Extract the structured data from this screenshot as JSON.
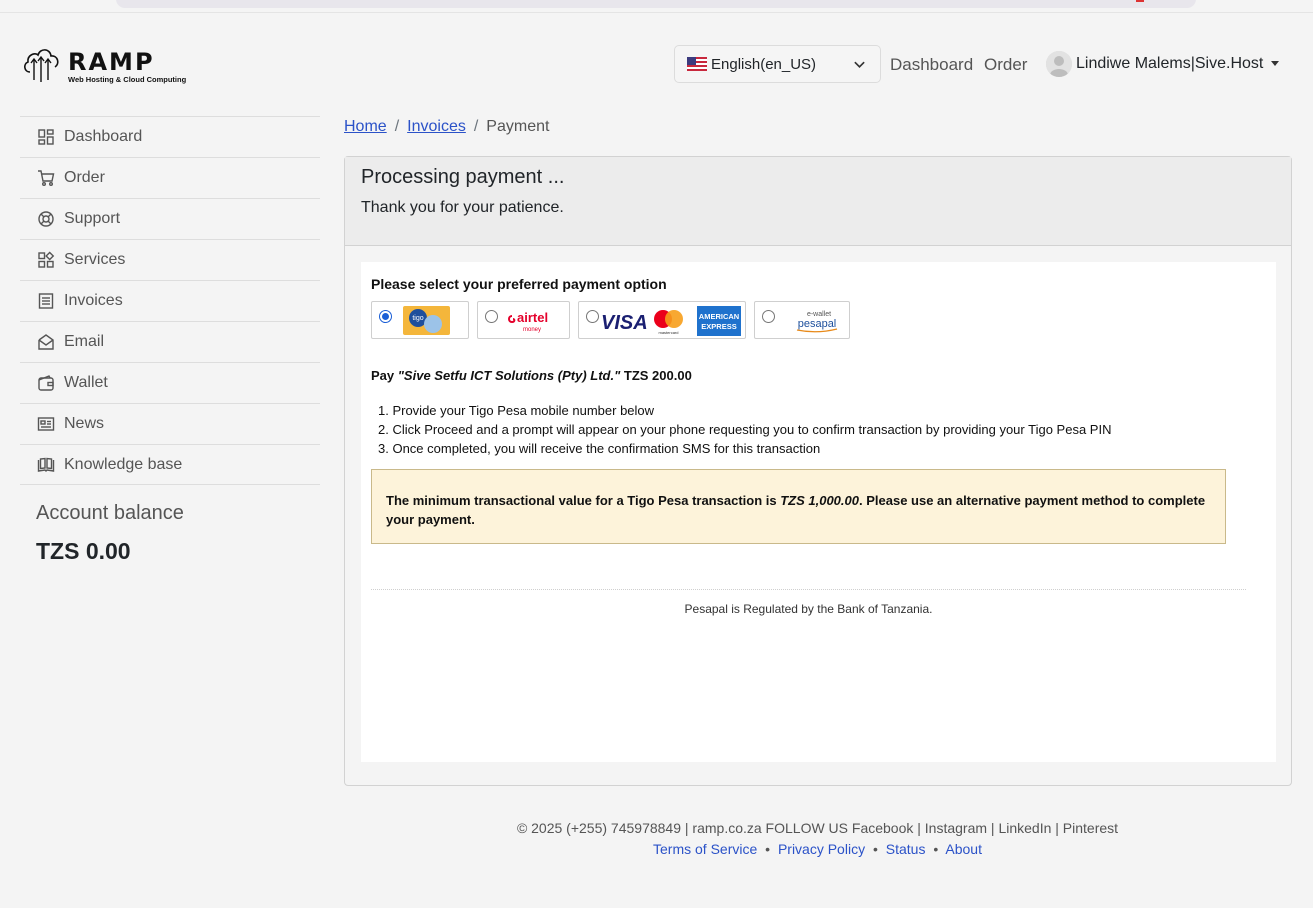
{
  "brand": {
    "name": "RAMP",
    "tagline": "Web Hosting & Cloud Computing"
  },
  "header": {
    "language": "English(en_US)",
    "nav": [
      "Dashboard",
      "Order"
    ],
    "user": "Lindiwe Malems|Sive.Host"
  },
  "sidebar": {
    "items": [
      {
        "label": "Dashboard",
        "icon": "dashboard-icon"
      },
      {
        "label": "Order",
        "icon": "cart-icon"
      },
      {
        "label": "Support",
        "icon": "lifebuoy-icon"
      },
      {
        "label": "Services",
        "icon": "services-icon"
      },
      {
        "label": "Invoices",
        "icon": "invoice-icon"
      },
      {
        "label": "Email",
        "icon": "envelope-icon"
      },
      {
        "label": "Wallet",
        "icon": "wallet-icon"
      },
      {
        "label": "News",
        "icon": "news-icon"
      },
      {
        "label": "Knowledge base",
        "icon": "book-icon"
      }
    ],
    "balance_label": "Account balance",
    "balance_value": "TZS 0.00"
  },
  "breadcrumb": {
    "home": "Home",
    "invoices": "Invoices",
    "current": "Payment",
    "sep": "/"
  },
  "panel": {
    "title": "Processing payment ...",
    "subtitle": "Thank you for your patience."
  },
  "payment": {
    "select_title": "Please select your preferred payment option",
    "options": [
      {
        "name": "Tigo Pesa",
        "selected": true,
        "logo_text": "tigo"
      },
      {
        "name": "Airtel Money",
        "selected": false,
        "logo_text": "airtel",
        "logo_sub": "money"
      },
      {
        "name": "Cards",
        "selected": false,
        "logo_text": "VISA",
        "amex_line1": "AMERICAN",
        "amex_line2": "EXPRESS",
        "mc_text": "mastercard"
      },
      {
        "name": "Pesapal e-wallet",
        "selected": false,
        "logo_text": "pesapal",
        "logo_sub": "e-wallet"
      }
    ],
    "pay_prefix": "Pay",
    "merchant": "\"Sive Setfu ICT Solutions (Pty) Ltd.\"",
    "amount": "TZS 200.00",
    "steps": [
      "1. Provide your Tigo Pesa mobile number below",
      "2. Click Proceed and a prompt will appear on your phone requesting you to confirm transaction by providing your Tigo Pesa PIN",
      "3. Once completed, you will receive the confirmation SMS for this transaction"
    ],
    "warning_prefix": "The minimum transactional value for a Tigo Pesa transaction is",
    "warning_amount": "TZS 1,000.00",
    "warning_suffix": ". Please use an alternative payment method to complete your payment.",
    "regulated": "Pesapal is Regulated by the Bank of Tanzania."
  },
  "footer": {
    "line1": "© 2025 (+255) 745978849 | ramp.co.za FOLLOW US Facebook | Instagram | LinkedIn | Pinterest",
    "links": [
      "Terms of Service",
      "Privacy Policy",
      "Status",
      "About"
    ],
    "sep": "•"
  },
  "colors": {
    "link": "#2b52c8",
    "warning_bg": "#fdf3da",
    "radio": "#1a5ed6"
  }
}
